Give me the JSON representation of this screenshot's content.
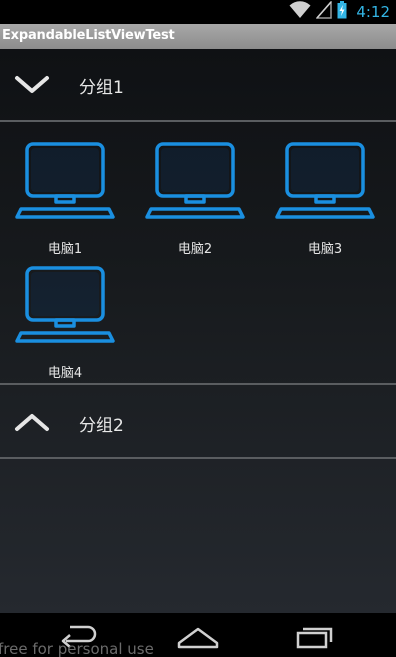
{
  "status_bar": {
    "time": "4:12",
    "icons": [
      "wifi-icon",
      "signal-icon",
      "battery-icon"
    ]
  },
  "app": {
    "title": "ExpandableListViewTest"
  },
  "groups": [
    {
      "label": "分组1",
      "expanded": true,
      "indicator_icon": "chevron-down-icon",
      "children": [
        {
          "label": "电脑1",
          "icon": "computer-icon"
        },
        {
          "label": "电脑2",
          "icon": "computer-icon"
        },
        {
          "label": "电脑3",
          "icon": "computer-icon"
        },
        {
          "label": "电脑4",
          "icon": "computer-icon"
        }
      ]
    },
    {
      "label": "分组2",
      "expanded": false,
      "indicator_icon": "chevron-up-icon",
      "children": []
    }
  ],
  "nav_bar": {
    "buttons": [
      "back-icon",
      "home-icon",
      "recent-apps-icon"
    ]
  },
  "watermark": "free for personal use",
  "colors": {
    "accent": "#33b5e5",
    "computer_blue": "#1a8fe0",
    "title_bar": "#9a9a9a",
    "divider": "#5a5d60"
  }
}
